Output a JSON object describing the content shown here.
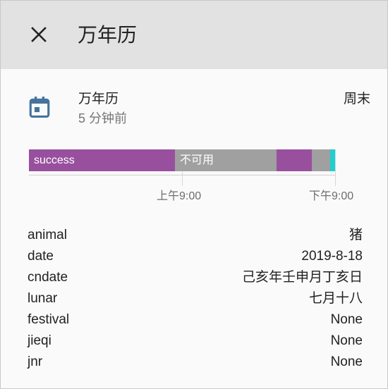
{
  "dialog": {
    "title": "万年历",
    "close_icon": "close-icon"
  },
  "entity": {
    "icon": "calendar-icon",
    "name": "万年历",
    "last_changed": "5 分钟前",
    "state": "周末"
  },
  "history": {
    "segments": [
      {
        "label": "success",
        "color": "#98509e"
      },
      {
        "label": "不可用",
        "color": "#a0a0a0"
      },
      {
        "label": "",
        "color": "#98509e"
      },
      {
        "label": "",
        "color": "#a0a0a0"
      },
      {
        "label": "",
        "color": "#1fcfcf"
      }
    ],
    "ticks": [
      "上午9:00",
      "下午9:00"
    ]
  },
  "attributes": [
    {
      "key": "animal",
      "value": "猪"
    },
    {
      "key": "date",
      "value": "2019-8-18"
    },
    {
      "key": "cndate",
      "value": "己亥年壬申月丁亥日"
    },
    {
      "key": "lunar",
      "value": "七月十八"
    },
    {
      "key": "festival",
      "value": "None"
    },
    {
      "key": "jieqi",
      "value": "None"
    },
    {
      "key": "jnr",
      "value": "None"
    }
  ]
}
